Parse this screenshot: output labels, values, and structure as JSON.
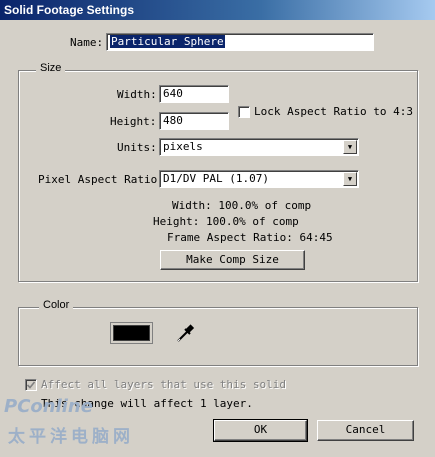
{
  "window": {
    "title": "Solid Footage Settings"
  },
  "name_field": {
    "label": "Name:",
    "value": "Particular Sphere"
  },
  "size": {
    "group_label": "Size",
    "width_label": "Width:",
    "width_value": "640",
    "height_label": "Height:",
    "height_value": "480",
    "lock_aspect_label": "Lock Aspect Ratio to 4:3",
    "lock_aspect_checked": false,
    "units_label": "Units:",
    "units_value": "pixels",
    "par_label": "Pixel Aspect Ratio:",
    "par_value": "D1/DV PAL (1.07)",
    "width_info": "Width: 100.0% of comp",
    "height_info": "Height: 100.0% of comp",
    "frame_aspect": "Frame Aspect Ratio: 64:45",
    "make_comp_size": "Make Comp Size"
  },
  "color": {
    "group_label": "Color",
    "swatch_color": "#000000",
    "eyedropper_icon": "eyedropper-icon"
  },
  "affect_all": {
    "label": "Affect all layers that use this solid",
    "checked": true,
    "enabled": false
  },
  "status_text": "This change will affect 1 layer.",
  "buttons": {
    "ok": "OK",
    "cancel": "Cancel"
  },
  "watermark": {
    "latin": "PConline",
    "cjk": "太平洋电脑网"
  }
}
